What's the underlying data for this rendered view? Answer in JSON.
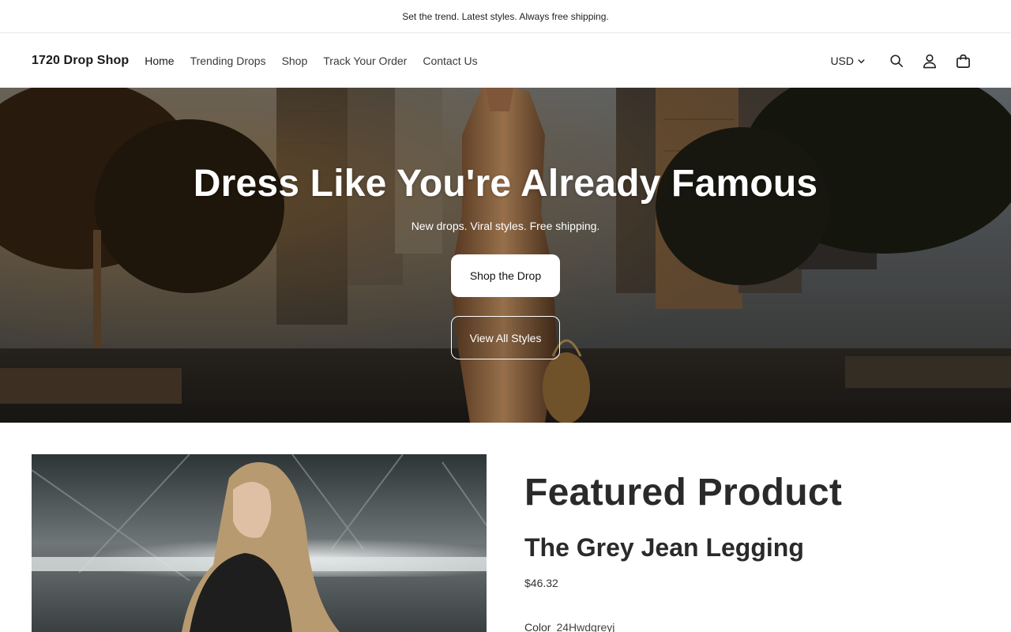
{
  "announcement": "Set the trend. Latest styles. Always free shipping.",
  "header": {
    "logo": "1720 Drop Shop",
    "nav": [
      {
        "label": "Home"
      },
      {
        "label": "Trending Drops"
      },
      {
        "label": "Shop"
      },
      {
        "label": "Track Your Order"
      },
      {
        "label": "Contact Us"
      }
    ],
    "currency": "USD",
    "icons": [
      "chevron-down-icon",
      "search-icon",
      "account-icon",
      "cart-icon"
    ]
  },
  "hero": {
    "title": "Dress Like You're Already Famous",
    "subtitle": "New drops. Viral styles. Free shipping.",
    "primary_button": "Shop the Drop",
    "secondary_button": "View All Styles"
  },
  "featured": {
    "heading": "Featured Product",
    "product_name": "The Grey Jean Legging",
    "price": "$46.32",
    "color_label": "Color",
    "color_value": "24Hwdgreyj"
  },
  "colors": {
    "text": "#222222",
    "border": "#e8e8e8",
    "button_bg": "#ffffff"
  }
}
